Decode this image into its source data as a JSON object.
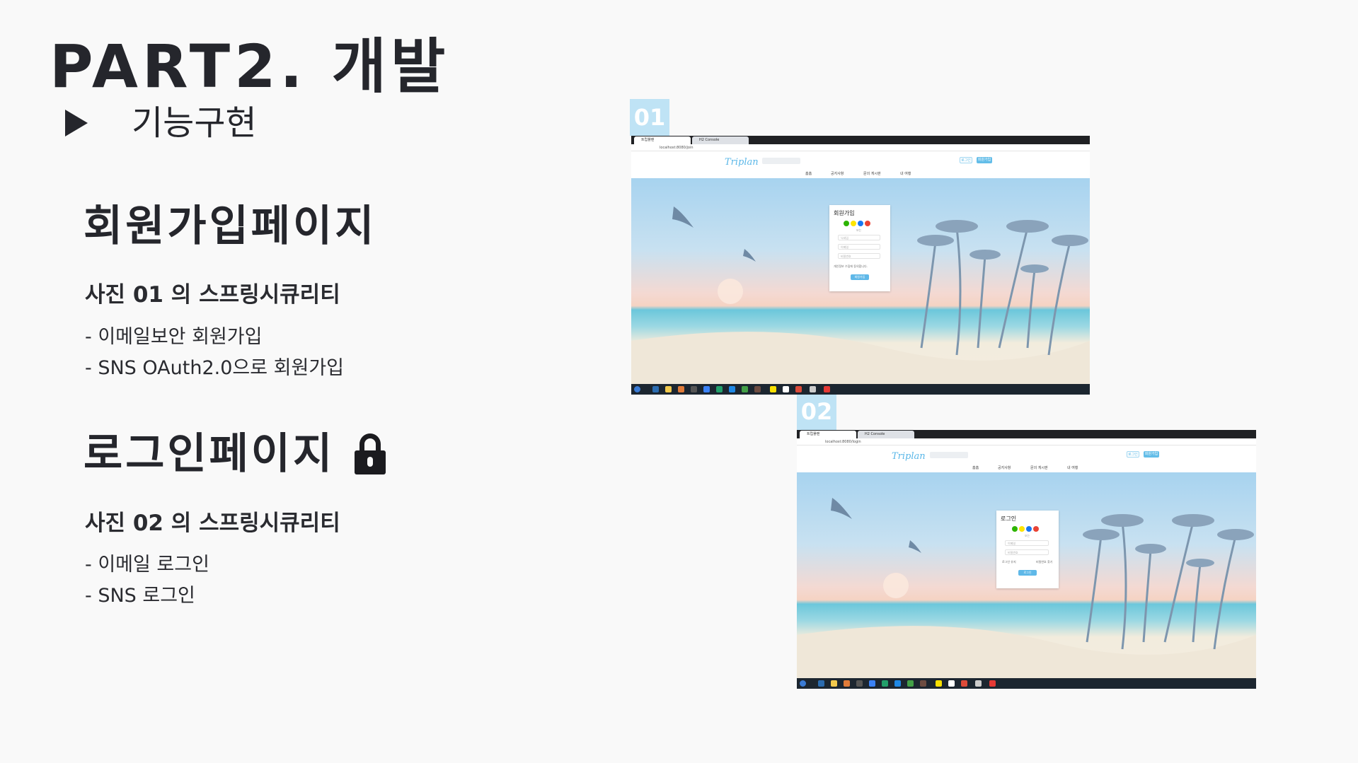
{
  "header": {
    "title": "PART2. 개발",
    "subtitle": "기능구현"
  },
  "signup": {
    "heading": "회원가입페이지",
    "subheading": "사진 01 의 스프링시큐리티",
    "items": [
      "- 이메일보안 회원가입",
      "- SNS OAuth2.0으로 회원가입"
    ]
  },
  "login": {
    "heading": "로그인페이지",
    "subheading": "사진 02 의 스프링시큐리티",
    "items": [
      "- 이메일 로그인",
      "- SNS  로그인"
    ]
  },
  "screenshots": [
    {
      "badge": "01",
      "tabs": [
        "트립플랜",
        "H2 Console"
      ],
      "url": "localhost:8080/join",
      "logo": "Triplan",
      "login_btn": "로그인",
      "signup_btn": "회원가입",
      "nav": [
        "홈홈",
        "공지사항",
        "문의 게시판",
        "내 여행"
      ],
      "modal": {
        "title": "회원가입",
        "or_label": "또는",
        "fields": [
          "닉네임",
          "이메일",
          "비밀번호"
        ],
        "agree": "개인정보 수집에 동의합니다.",
        "submit": "회원가입"
      }
    },
    {
      "badge": "02",
      "tabs": [
        "트립플랜",
        "H2 Console"
      ],
      "url": "localhost:8080/login",
      "logo": "Triplan",
      "login_btn": "로그인",
      "signup_btn": "회원가입",
      "nav": [
        "홈홈",
        "공지사항",
        "문의 게시판",
        "내 여행"
      ],
      "modal": {
        "title": "로그인",
        "or_label": "또는",
        "fields": [
          "이메일",
          "비밀번호"
        ],
        "remember": "로그인 유지",
        "forgot": "비밀번호 찾기",
        "submit": "로그인"
      }
    }
  ],
  "colors": {
    "badge": "#bfe3f5",
    "accent": "#5fb8e8",
    "text": "#25262c"
  }
}
